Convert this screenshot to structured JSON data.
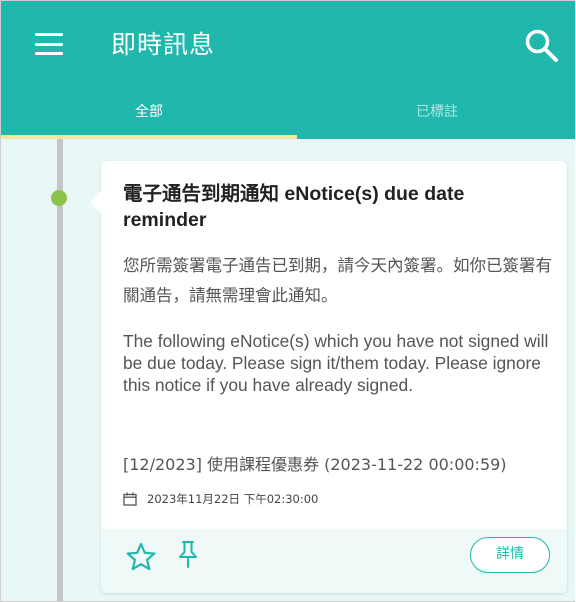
{
  "app_bar": {
    "title": "即時訊息",
    "menu_icon": "hamburger-menu-icon",
    "search_icon": "search-icon",
    "background_color": "#20b7ad"
  },
  "tabs": [
    {
      "label": "全部",
      "selected": true
    },
    {
      "label": "已標註",
      "selected": false
    }
  ],
  "accent_colors": {
    "primary": "#20b7ad",
    "tab_indicator": "#f2e6a3",
    "unread_dot": "#8bc34a"
  },
  "notification": {
    "title": "電子通告到期通知 eNotice(s) due date reminder",
    "message_zh": "您所需簽署電子通告已到期，請今天內簽署。如你已簽署有關通告，請無需理會此通知。",
    "message_en": "The following eNotice(s) which you have not signed will be due today. Please sign it/them today. Please ignore this notice if you have already signed.",
    "notice_item": "[12/2023] 使用課程優惠券 (2023-11-22 00:00:59)",
    "timestamp": "2023年11月22日 下午02:30:00",
    "timestamp_icon": "calendar-icon",
    "star_icon": "star-outline-icon",
    "pin_icon": "pin-outline-icon",
    "details_button_label": "詳情"
  }
}
